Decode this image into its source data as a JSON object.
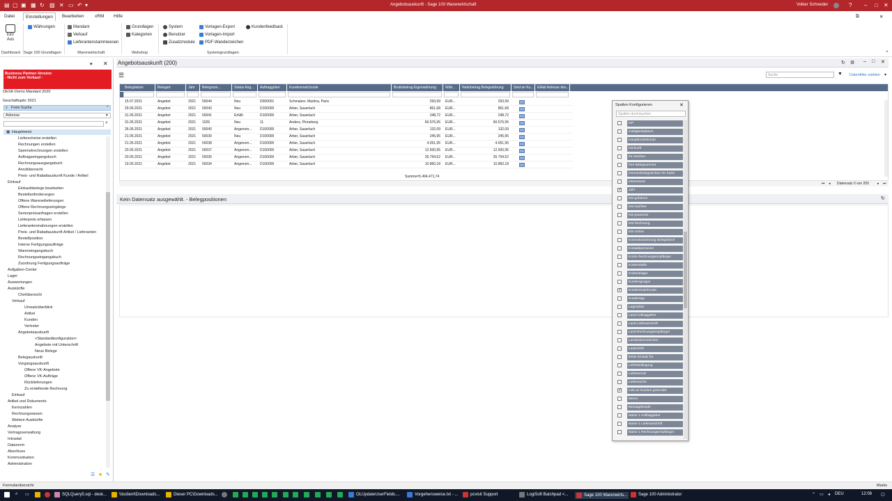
{
  "titlebar": {
    "title": "Angebotsauskunft - Sage 100 Warenwirtschaft",
    "user": "Volker Schneider",
    "accent": "#b3262a"
  },
  "menu": [
    "Datei",
    "Einstellungen",
    "Bearbeiten",
    "xRM",
    "Hilfe"
  ],
  "ribbon": {
    "dashboard": "Dashboard",
    "einaus": "Ein/\nAus",
    "waehrungen": "Währungen",
    "mandant": "Mandant",
    "verkauf": "Verkauf",
    "lieferantenstamm": "Lieferantenstammwesen",
    "grundlagen": "Grundlagen",
    "kategorien": "Kategorien",
    "system": "System",
    "benutzer": "Benutzer",
    "zusatzmodule": "Zusatzmodule",
    "vorlagen_export": "Vorlagen-Export",
    "vorlagen_import": "Vorlagen-Import",
    "pdf": "PDF-Wanderzeichen",
    "kundenfeedback": "Kundenfeedback",
    "groups": [
      "Dashboard",
      "Sage 100 Grundlagen",
      "Warenwirtschaft",
      "Webshop",
      "Systemgrundlagen"
    ]
  },
  "left": {
    "banner1": "Business Partner-Version",
    "banner2": "- Nicht zum Verkauf -",
    "mandant": "OESK-Demo Mandant 2020",
    "gj": "Geschäftsjahr 2021",
    "search": "Freie Suche",
    "adresse": "Adresse",
    "hauptmenu": "Hauptmenü",
    "tree": [
      "Lieferscheine erstellen",
      "Rechnungen erstellen",
      "Sammelrechnungen erstellen",
      "Auftragseingangsbuch",
      "Rechnungsausgangsbuch",
      "Anrufübersicht",
      "Preis- und Rabattauskunft Kunde / Artikel",
      "Einkauf",
      "Einkaufsbelege bearbeiten",
      "Bestellanforderungen",
      "Offene Wareneilieferungen",
      "Offene Rechnungseingänge",
      "Serienpreisanfragen erstellen",
      "Lieferpreis erfassen",
      "Lieferantenmahnungen erstellen",
      "Preis- und Rabattauskunft Artikel / Lieferanten",
      "Bestellposition",
      "Interne Fertigungsaufträge",
      "Wareneingangsbuch",
      "Rechnungseingangsbuch",
      "Zuordnung Fertigungsaufträge",
      "Aufgaben-Center",
      "Lager",
      "Auswertungen",
      "Auskünfte",
      "Chefübersicht",
      "Verkauf",
      "Umsatzüberblick",
      "Artikel",
      "Kunden",
      "Vertreter",
      "Angebotsauskunft",
      "<Standardkonfiguration>",
      "Angebote mit Unterschrift",
      "Neue Belege",
      "Belegauskunft",
      "Vorgangsauskunft",
      "Offene VK-Angebote",
      "Offene VK-Aufträge",
      "Rücklieferungen",
      "Zu erstellende Rechnung",
      "Einkauf",
      "Artikel und Dokumente",
      "Kennzahlen",
      "Rechnungswesen",
      "Weitere Auskünfte",
      "Analyse",
      "Vertragsverwaltung",
      "Intrastat",
      "Datanorm",
      "Abschluss",
      "Kommunikation",
      "Administration"
    ]
  },
  "main": {
    "title": "Angebotsauskunft (200)",
    "search_ph": "Suche",
    "filter": "Datenfilter wählen",
    "columns": [
      "Belegdatum",
      "Belegart",
      "Jahr",
      "Belegnum...",
      "Status Ang...",
      "Auftraggeber",
      "Kundenmatchcode",
      "Bruttobetrag Eigenwährung",
      "Wäh...",
      "Nettobetrag Belegwährung",
      "Sind an Ku...",
      "EMail Adresse des..."
    ],
    "rows": [
      [
        "15.07.2021",
        "Angebot",
        "2021",
        "50044",
        "Neu",
        "D000001",
        "Schmalzer, Martina, Paris",
        "293,99",
        "EUR...",
        "293,99"
      ],
      [
        "29.06.2021",
        "Angebot",
        "2021",
        "50043",
        "Neu",
        "D100000",
        "Arber, Sauerlach",
        "861,68",
        "EUR...",
        "861,68"
      ],
      [
        "31.05.2021",
        "Angebot",
        "2021",
        "50041",
        "Erfüllt",
        "D100000",
        "Arber, Sauerlach",
        "248,72",
        "EUR...",
        "248,72"
      ],
      [
        "31.05.2021",
        "Angebot",
        "2021",
        "1026",
        "Neu",
        "11",
        "Anders, Pinneberg",
        "60.576,95",
        "EUR...",
        "60.576,95"
      ],
      [
        "26.05.2021",
        "Angebot",
        "2021",
        "50040",
        "Angenom...",
        "D100000",
        "Arber, Sauerlach",
        "132,09",
        "EUR...",
        "132,09"
      ],
      [
        "21.05.2021",
        "Angebot",
        "2021",
        "50039",
        "Neu",
        "D100000",
        "Arber, Sauerlach",
        "245,95",
        "EUR...",
        "245,95"
      ],
      [
        "21.05.2021",
        "Angebot",
        "2021",
        "50038",
        "Angenom...",
        "D100000",
        "Arber, Sauerlach",
        "4.051,95",
        "EUR...",
        "4.051,95"
      ],
      [
        "20.05.2021",
        "Angebot",
        "2021",
        "50037",
        "Angenom...",
        "D100000",
        "Arber, Sauerlach",
        "12.500,95",
        "EUR...",
        "12.500,95"
      ],
      [
        "20.05.2021",
        "Angebot",
        "2021",
        "50036",
        "Angenom...",
        "D100000",
        "Arber, Sauerlach",
        "26.794,52",
        "EUR...",
        "26.794,52"
      ],
      [
        "19.05.2021",
        "Angebot",
        "2021",
        "50034",
        "Angenom...",
        "D100000",
        "Arber, Sauerlach",
        "10.860,18",
        "EUR...",
        "10.860,18"
      ]
    ],
    "sum": "Summe=5.494.471,74",
    "record": "Datensatz 0 von 200",
    "positions": "Kein Datensatz ausgewählt. - Belegpositionen"
  },
  "dialog": {
    "title": "Spalten Konfigurieren",
    "search_ph": "Spalten durchsuchen",
    "items": [
      {
        "l": "GP",
        "c": false
      },
      {
        "l": "Gültigkeitsdatum",
        "c": false
      },
      {
        "l": "Hauptkontenkonto",
        "c": false
      },
      {
        "l": "Herkunft",
        "c": false
      },
      {
        "l": "Ihr Zeichen",
        "c": false
      },
      {
        "l": "Ihre Belegnummer",
        "c": false
      },
      {
        "l": "Inventurbelegzeichen VK Karte",
        "c": false
      },
      {
        "l": "Interessent",
        "c": false
      },
      {
        "l": "Jahr",
        "c": true
      },
      {
        "l": "KM gefahren",
        "c": false
      },
      {
        "l": "KM nachher",
        "c": false
      },
      {
        "l": "KM pauschal",
        "c": false
      },
      {
        "l": "KM Rechnung",
        "c": false
      },
      {
        "l": "KM vorher",
        "c": false
      },
      {
        "l": "Kommissionierung Belegebene",
        "c": false
      },
      {
        "l": "Kontaktpersonen",
        "c": false
      },
      {
        "l": "Konto Rechnungsempfänger",
        "c": false
      },
      {
        "l": "Kostenstelle",
        "c": false
      },
      {
        "l": "Kostenträger",
        "c": false
      },
      {
        "l": "Kundengruppe",
        "c": false
      },
      {
        "l": "Kundenmatchcode",
        "c": true
      },
      {
        "l": "Kundentyp",
        "c": false
      },
      {
        "l": "Lagerplatz",
        "c": false
      },
      {
        "l": "Land Auftraggeber",
        "c": false
      },
      {
        "l": "Land Lieferanschrift",
        "c": false
      },
      {
        "l": "Land Rechnungsempfänger",
        "c": false
      },
      {
        "l": "Landeskennzeichen",
        "c": false
      },
      {
        "l": "Lastschrift",
        "c": false
      },
      {
        "l": "letzte Einsatz für",
        "c": false
      },
      {
        "l": "Lieferbedingung",
        "c": false
      },
      {
        "l": "Liefertermin",
        "c": false
      },
      {
        "l": "Lieferwoche",
        "c": false
      },
      {
        "l": "Link an Kunden gesendet",
        "c": true
      },
      {
        "l": "Memo",
        "c": false
      },
      {
        "l": "Montagekunde",
        "c": false
      },
      {
        "l": "Name 1 Auftraggeber",
        "c": false
      },
      {
        "l": "Name 1 Lieferanschrift",
        "c": false
      },
      {
        "l": "Name 1 Rechnungsempfänger",
        "c": false
      }
    ]
  },
  "status": {
    "left": "Formularübersicht",
    "right": "Marks"
  },
  "taskbar": [
    "SQLQuery5.sql - desk...",
    "\\\\tsclient\\Downloads...",
    "Dieser PC\\Downloads...",
    "OLUpdateUserFields....",
    "Vorgehensweise.txt - ...",
    "pcvisit Support",
    "LogiSoft Batchpad <...",
    "Sage 100 Warenwirts...",
    "Sage 100 Administrator"
  ],
  "clock": "12:08",
  "lang": "DEU"
}
